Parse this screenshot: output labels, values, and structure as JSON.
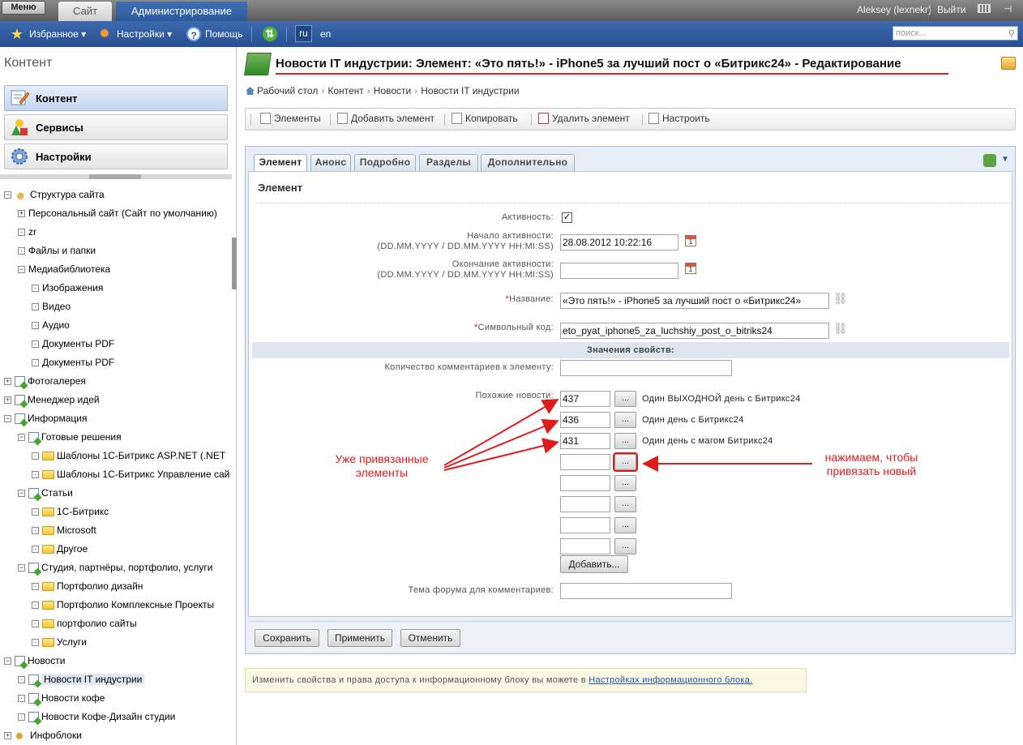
{
  "topbar": {
    "menu_label": "Меню",
    "tabs": [
      {
        "label": "Сайт"
      },
      {
        "label": "Администрирование"
      }
    ],
    "user": "Aleksey (lexnekr)",
    "logout": "Выйти"
  },
  "toolbar": {
    "favorites": "Избранное ▾",
    "settings": "Настройки ▾",
    "help": "Помощь",
    "lang_ru": "ru",
    "lang_en": "en",
    "search_placeholder": "поиск..."
  },
  "left": {
    "title": "Контент",
    "buttons": [
      {
        "label": "Контент"
      },
      {
        "label": "Сервисы"
      },
      {
        "label": "Настройки"
      }
    ],
    "tree": [
      {
        "label": "Структура сайта",
        "toggle": "−",
        "icon": "person"
      },
      {
        "label": "Персональный сайт (Сайт по умолчанию)",
        "toggle": "+",
        "icon": "none"
      },
      {
        "label": "zr",
        "toggle": "·",
        "icon": "none"
      },
      {
        "label": "Файлы и папки",
        "toggle": "·",
        "icon": "none"
      },
      {
        "label": "Медиабиблиотека",
        "toggle": "−",
        "icon": "none"
      },
      {
        "label": "Изображения",
        "toggle": "·",
        "icon": "none"
      },
      {
        "label": "Видео",
        "toggle": "·",
        "icon": "none"
      },
      {
        "label": "Аудио",
        "toggle": "·",
        "icon": "none"
      },
      {
        "label": "Документы PDF",
        "toggle": "·",
        "icon": "none"
      },
      {
        "label": "Документы PDF",
        "toggle": "·",
        "icon": "none"
      },
      {
        "label": "Фотогалерея",
        "toggle": "+",
        "icon": "iblock"
      },
      {
        "label": "Менеджер идей",
        "toggle": "+",
        "icon": "iblock"
      },
      {
        "label": "Информация",
        "toggle": "−",
        "icon": "iblock"
      },
      {
        "label": "Готовые решения",
        "toggle": "−",
        "icon": "iblock"
      },
      {
        "label": "Шаблоны 1С-Битрикс ASP.NET (.NET",
        "toggle": "·",
        "icon": "folder"
      },
      {
        "label": "Шаблоны 1С-Битрикс Управление сай",
        "toggle": "·",
        "icon": "folder"
      },
      {
        "label": "Статьи",
        "toggle": "−",
        "icon": "iblock"
      },
      {
        "label": "1С-Битрикс",
        "toggle": "·",
        "icon": "folder"
      },
      {
        "label": "Microsoft",
        "toggle": "·",
        "icon": "folder"
      },
      {
        "label": "Другое",
        "toggle": "·",
        "icon": "folder"
      },
      {
        "label": "Студия, партнёры, портфолио, услуги",
        "toggle": "−",
        "icon": "iblock"
      },
      {
        "label": "Портфолио дизайн",
        "toggle": "·",
        "icon": "folder"
      },
      {
        "label": "Портфолио Комплексные Проекты",
        "toggle": "·",
        "icon": "folder"
      },
      {
        "label": "портфолио сайты",
        "toggle": "·",
        "icon": "folder"
      },
      {
        "label": "Услуги",
        "toggle": "·",
        "icon": "folder"
      },
      {
        "label": "Новости",
        "toggle": "−",
        "icon": "iblock"
      },
      {
        "label": "Новости IT индустрии",
        "toggle": "·",
        "icon": "iblock"
      },
      {
        "label": "Новости кофе",
        "toggle": "·",
        "icon": "iblock"
      },
      {
        "label": "Новости Кофе-Дизайн студии",
        "toggle": "·",
        "icon": "iblock"
      },
      {
        "label": "Инфоблоки",
        "toggle": "+",
        "icon": "blocks"
      }
    ]
  },
  "page": {
    "title": "Новости IT индустрии: Элемент: «Это пять!» - iPhone5 за лучший пост о «Битрикс24» - Редактирование",
    "breadcrumb": [
      "Рабочий стол",
      "Контент",
      "Новости",
      "Новости IT индустрии"
    ],
    "actions": [
      "Элементы",
      "Добавить элемент",
      "Копировать",
      "Удалить элемент",
      "Настроить"
    ]
  },
  "form": {
    "tabs": [
      "Элемент",
      "Анонс",
      "Подробно",
      "Разделы",
      "Дополнительно"
    ],
    "section_title": "Элемент",
    "active_label": "Активность:",
    "active_check": "✓",
    "start_label_1": "Начало активности:",
    "start_label_2": "(DD.MM.YYYY / DD.MM.YYYY HH:MI:SS)",
    "start_value": "28.08.2012 10:22:16",
    "end_label_1": "Окончание активности:",
    "end_label_2": "(DD.MM.YYYY / DD.MM.YYYY HH:MI:SS)",
    "end_value": "",
    "name_label": "Название:",
    "name_value": "«Это пять!» - iPhone5 за лучший пост о «Битрикс24»",
    "code_label": "Символьный код:",
    "code_value": "eto_pyat_iphone5_za_luchshiy_post_o_bitriks24",
    "props_title": "Значения свойств:",
    "comments_label": "Количество комментариев к элементу:",
    "comments_value": "",
    "similar_label": "Похожие новости:",
    "similar": [
      {
        "id": "437",
        "name": "Один ВЫХОДНОЙ день с Битрикс24"
      },
      {
        "id": "436",
        "name": "Один день с Битрикс24"
      },
      {
        "id": "431",
        "name": "Один день с магом Битрикс24"
      },
      {
        "id": "",
        "name": ""
      },
      {
        "id": "",
        "name": ""
      },
      {
        "id": "",
        "name": ""
      },
      {
        "id": "",
        "name": ""
      },
      {
        "id": "",
        "name": ""
      }
    ],
    "pick_label": "...",
    "add_label": "Добавить...",
    "forum_label": "Тема форума для комментариев:",
    "forum_value": "",
    "required_mark": "*",
    "buttons": {
      "save": "Сохранить",
      "apply": "Применить",
      "cancel": "Отменить"
    }
  },
  "info_note": {
    "text": "Изменить свойства и права доступа к информационному блоку вы можете в ",
    "link": "Настройках информационного блока."
  },
  "annotations": {
    "left_1": "Уже привязанные",
    "left_2": "элементы",
    "right_1": "нажимаем, чтобы",
    "right_2": "привязать новый",
    "color": "#e01b1b"
  }
}
